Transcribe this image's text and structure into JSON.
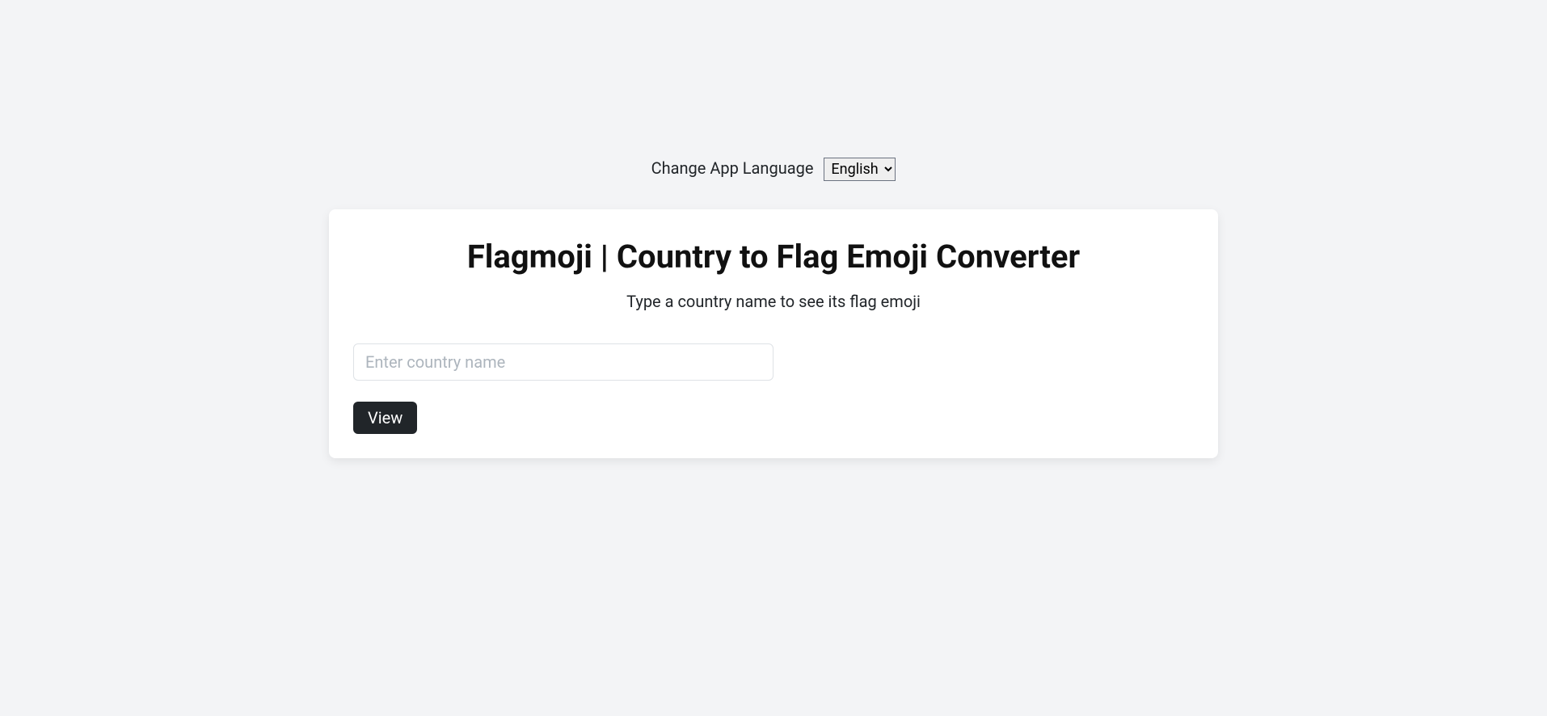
{
  "language": {
    "label": "Change App Language",
    "selected": "English"
  },
  "card": {
    "title": "Flagmoji | Country to Flag Emoji Converter",
    "subtitle": "Type a country name to see its flag emoji",
    "input_placeholder": "Enter country name",
    "input_value": "",
    "button_label": "View"
  }
}
